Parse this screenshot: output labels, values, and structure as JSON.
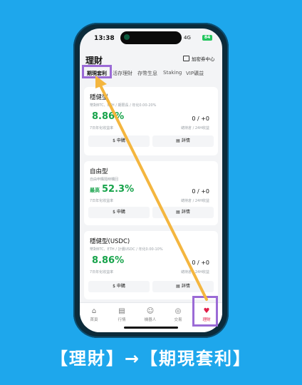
{
  "status": {
    "time": "13:38",
    "network": "4G",
    "battery": "84"
  },
  "header": {
    "title": "理財",
    "enter_label": "加密券中心"
  },
  "tabs": [
    {
      "label": "期現套利",
      "active": true
    },
    {
      "label": "活存理財",
      "active": false
    },
    {
      "label": "存幣生息",
      "active": false
    },
    {
      "label": "Staking",
      "active": false
    },
    {
      "label": "VIP礦益",
      "active": false
    }
  ],
  "cards": [
    {
      "title": "穩健型",
      "desc": "幣對BTC、ETH / 期限長 / 年化0.00-20%",
      "rate_prefix": "",
      "rate": "8.86%",
      "rate_sub": "7日年化收益率",
      "count": "0 / +0",
      "count_sub": "總持倉 / 24H收益",
      "apply": "申購",
      "details": "詳情"
    },
    {
      "title": "自由型",
      "desc": "自由申購隨時贖回",
      "rate_prefix": "最高",
      "rate": "52.3%",
      "rate_sub": "7日年化收益率",
      "count": "0 / +0",
      "count_sub": "總持倉 / 24H收益",
      "apply": "申購",
      "details": "詳情"
    },
    {
      "title": "穩健型(USDC)",
      "desc": "幣對BTC、ETH / 計價USDC / 年化0.00-10%",
      "rate_prefix": "",
      "rate": "8.86%",
      "rate_sub": "7日年化收益率",
      "count": "0 / +0",
      "count_sub": "總持倉 / 24H收益",
      "apply": "申購",
      "details": "詳情"
    }
  ],
  "bottom_nav": [
    {
      "label": "首頁",
      "icon": "home-icon",
      "glyph": "⌂",
      "active": false
    },
    {
      "label": "行情",
      "icon": "chart-icon",
      "glyph": "▤",
      "active": false
    },
    {
      "label": "機器人",
      "icon": "robot-icon",
      "glyph": "☺",
      "active": false
    },
    {
      "label": "交易",
      "icon": "trade-icon",
      "glyph": "◎",
      "active": false
    },
    {
      "label": "理財",
      "icon": "heart-icon",
      "glyph": "♥",
      "active": true
    }
  ],
  "caption": "【理財】→【期現套利】",
  "colors": {
    "background": "#1ea7ec",
    "accent_green": "#16a34a",
    "highlight_purple": "#9b6bd6",
    "arrow": "#f4b63f",
    "active_red": "#e11d48"
  }
}
